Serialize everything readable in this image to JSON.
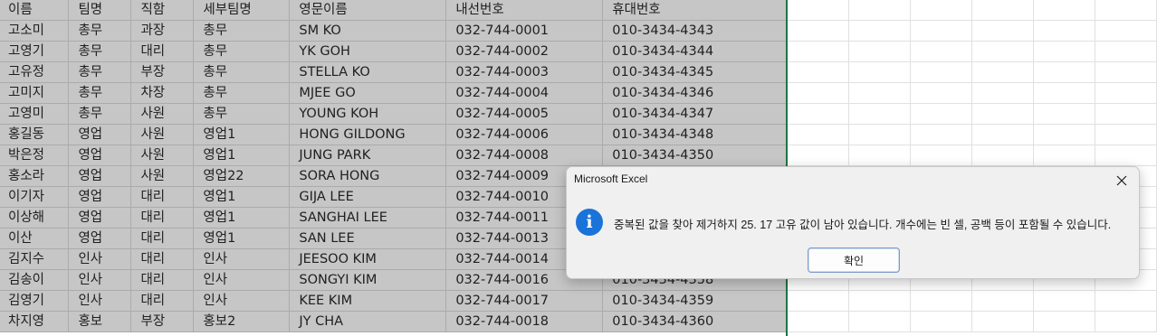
{
  "sheet": {
    "headers": [
      "이름",
      "팀명",
      "직함",
      "세부팀명",
      "영문이름",
      "내선번호",
      "휴대번호"
    ],
    "rows": [
      [
        "고소미",
        "총무",
        "과장",
        "총무",
        "SM KO",
        "032-744-0001",
        "010-3434-4343"
      ],
      [
        "고영기",
        "총무",
        "대리",
        "총무",
        "YK GOH",
        "032-744-0002",
        "010-3434-4344"
      ],
      [
        "고유정",
        "총무",
        "부장",
        "총무",
        "STELLA KO",
        "032-744-0003",
        "010-3434-4345"
      ],
      [
        "고미지",
        "총무",
        "차장",
        "총무",
        "MJEE GO",
        "032-744-0004",
        "010-3434-4346"
      ],
      [
        "고영미",
        "총무",
        "사원",
        "총무",
        "YOUNG KOH",
        "032-744-0005",
        "010-3434-4347"
      ],
      [
        "홍길동",
        "영업",
        "사원",
        "영업1",
        "HONG GILDONG",
        "032-744-0006",
        "010-3434-4348"
      ],
      [
        "박은정",
        "영업",
        "사원",
        "영업1",
        "JUNG PARK",
        "032-744-0008",
        "010-3434-4350"
      ],
      [
        "홍소라",
        "영업",
        "사원",
        "영업22",
        "SORA HONG",
        "032-744-0009",
        ""
      ],
      [
        "이기자",
        "영업",
        "대리",
        "영업1",
        "GIJA LEE",
        "032-744-0010",
        ""
      ],
      [
        "이상해",
        "영업",
        "대리",
        "영업1",
        "SANGHAI LEE",
        "032-744-0011",
        ""
      ],
      [
        "이산",
        "영업",
        "대리",
        "영업1",
        "SAN LEE",
        "032-744-0013",
        ""
      ],
      [
        "김지수",
        "인사",
        "대리",
        "인사",
        "JEESOO KIM",
        "032-744-0014",
        ""
      ],
      [
        "김송이",
        "인사",
        "대리",
        "인사",
        "SONGYI KIM",
        "032-744-0016",
        "010-3434-4358"
      ],
      [
        "김영기",
        "인사",
        "대리",
        "인사",
        "KEE KIM",
        "032-744-0017",
        "010-3434-4359"
      ],
      [
        "차지영",
        "홍보",
        "부장",
        "홍보2",
        "JY CHA",
        "032-744-0018",
        "010-3434-4360"
      ]
    ]
  },
  "dialog": {
    "title": "Microsoft Excel",
    "message": "중복된 값을 찾아 제거하지 25. 17 고유 값이 남아 있습니다. 개수에는 빈 셀, 공백 등이 포함될 수 있습니다.",
    "ok_label": "확인",
    "icon": "info-icon",
    "close_icon": "close-icon",
    "accent_color": "#1a73d9"
  },
  "colors": {
    "selection": "#c6c6c6",
    "selection_border": "#217346"
  }
}
